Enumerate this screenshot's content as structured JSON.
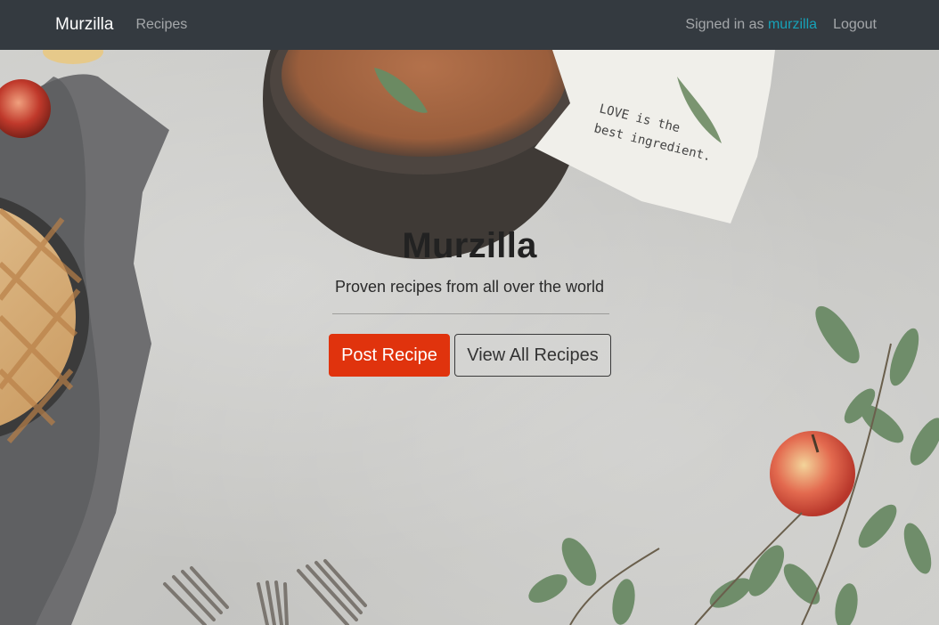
{
  "nav": {
    "brand": "Murzilla",
    "recipes_link": "Recipes",
    "signed_in_prefix": "Signed in as ",
    "username": "murzilla",
    "logout": "Logout"
  },
  "hero": {
    "title": "Murzilla",
    "lead": "Proven recipes from all over the world",
    "post_button": "Post Recipe",
    "view_button": "View All Recipes",
    "napkin_text_line1": "LOVE is the",
    "napkin_text_line2": "best ingredient."
  },
  "colors": {
    "navbar_bg": "#343a40",
    "accent_username": "#17a2b8",
    "primary_button": "#e0330d"
  }
}
